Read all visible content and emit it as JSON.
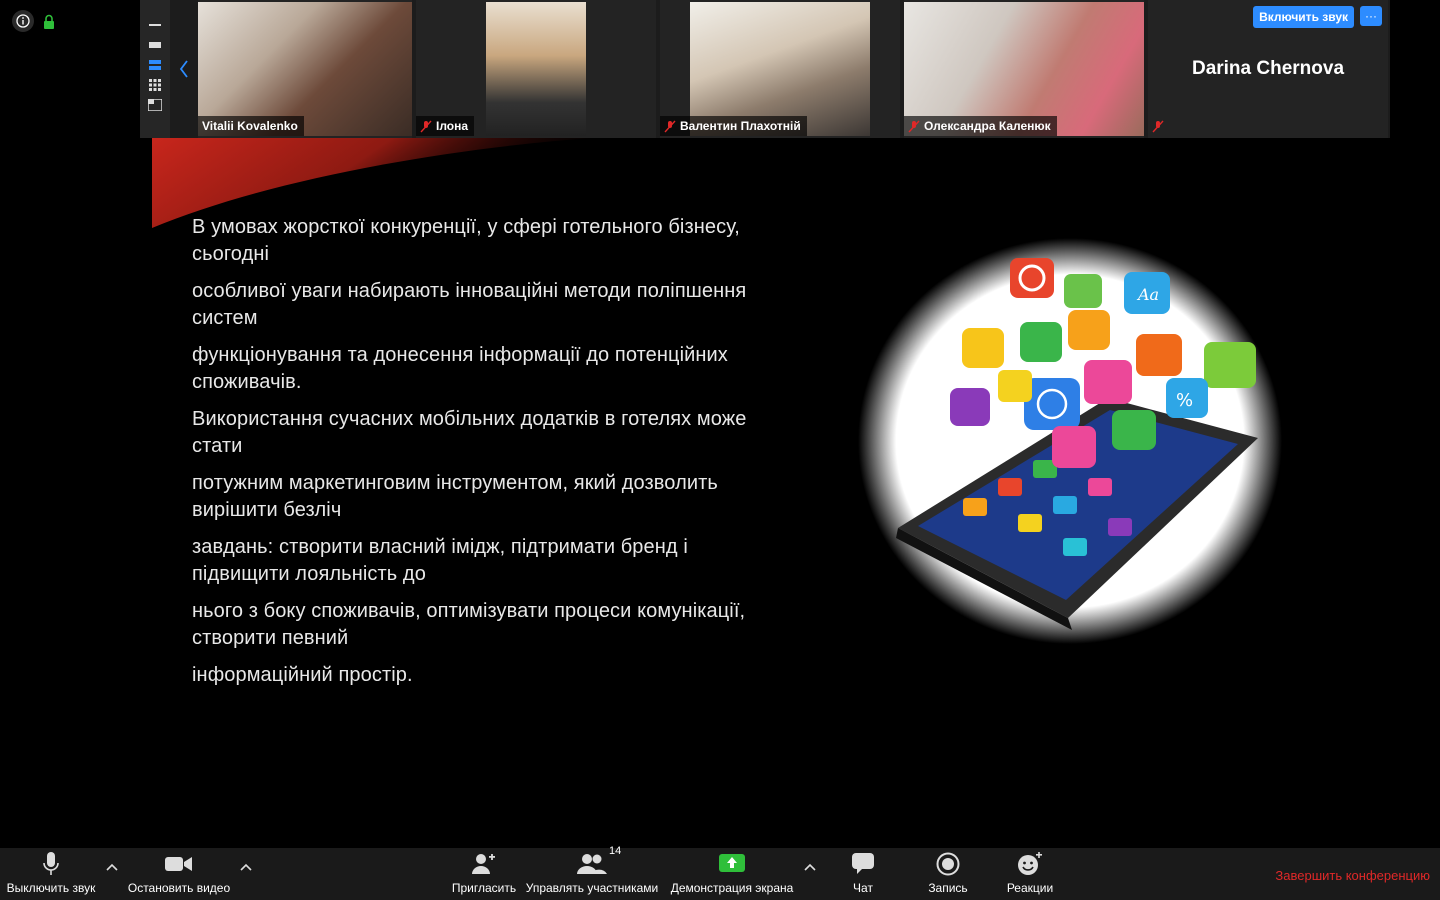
{
  "participants": [
    {
      "name": "Vitalii Kovalenko",
      "muted": false
    },
    {
      "name": "Ілона",
      "muted": true
    },
    {
      "name": "Валентин Плахотній",
      "muted": true
    },
    {
      "name": "Олександра Каленюк",
      "muted": true
    },
    {
      "name": "Darina Chernova",
      "muted": true
    }
  ],
  "strip_controls": {
    "unmute_label": "Включить звук",
    "more_label": "···"
  },
  "slide": {
    "paragraphs": [
      "В умовах жорсткої конкуренції, у сфері готельного бізнесу, сьогодні",
      "особливої уваги набирають інноваційні методи поліпшення систем",
      "функціонування та донесення інформації до потенційних споживачів.",
      "Використання сучасних мобільних додатків в готелях може стати",
      "потужним маркетинговим інструментом, який дозволить вирішити безліч",
      "завдань: створити власний імідж, підтримати бренд і підвищити лояльність до",
      "нього з боку споживачів, оптимізувати процеси комунікації, створити певний",
      "інформаційний простір."
    ]
  },
  "toolbar": {
    "mute": "Выключить звук",
    "stop_video": "Остановить видео",
    "invite": "Пригласить",
    "participants": "Управлять участниками",
    "participants_count": "14",
    "share": "Демонстрация экрана",
    "chat": "Чат",
    "record": "Запись",
    "reactions": "Реакции",
    "end": "Завершить конференцию"
  },
  "colors": {
    "accent_blue": "#2d8cff",
    "end_red": "#e02828",
    "share_green": "#2fbf3a",
    "slide_red": "#c8261c"
  }
}
